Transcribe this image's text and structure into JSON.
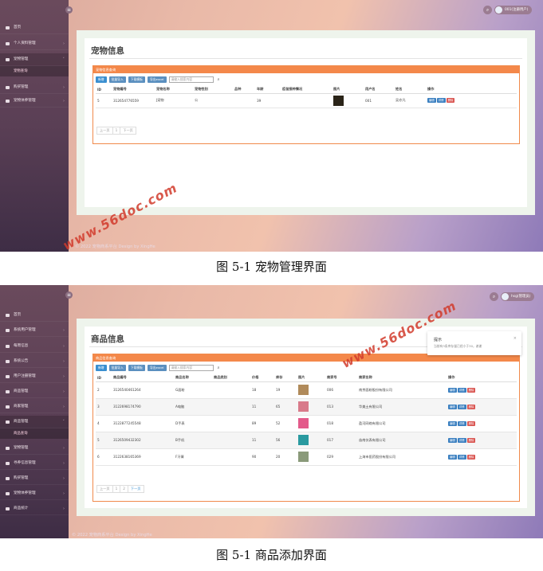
{
  "figure1": {
    "sidebar": {
      "items": [
        {
          "label": "首页"
        },
        {
          "label": "个人资料管理"
        },
        {
          "label": "宠物管理"
        },
        {
          "label": "购买管理"
        },
        {
          "label": "宠物体养管理"
        }
      ],
      "sub_label": "宠物查询"
    },
    "user_label": "001(注册用户)",
    "page_title": "宠物信息",
    "card_title": "宠物信息查询",
    "toolbar": {
      "add": "新增",
      "import": "批量导入",
      "template": "下载模板",
      "export": "导出excel",
      "search_placeholder": "请输入搜索内容"
    },
    "columns": [
      "ID",
      "宠物编号",
      "宠物名称",
      "宠物性别",
      "品种",
      "年龄",
      "疫苗接种情况",
      "图片",
      "用户名",
      "姓名",
      "操作"
    ],
    "rows": [
      {
        "id": "5",
        "code": "312654776559",
        "name": "J宠物",
        "sex": "公",
        "breed": "",
        "age": "39",
        "vaccine": "",
        "img": "",
        "user": "001",
        "realname": "吴亦凡"
      }
    ],
    "ops": {
      "edit": "编辑",
      "detail": "详情",
      "delete": "删除"
    },
    "pager": {
      "prev": "上一页",
      "pages": [
        "1"
      ],
      "next": "下一页"
    },
    "footer": "© 2022 宠物商系平台 Design by XingHe",
    "watermark": "www.56doc.com",
    "caption": "图 5-1  宠物管理界面"
  },
  "figure2": {
    "sidebar": {
      "items": [
        {
          "label": "首页"
        },
        {
          "label": "系统用户管理"
        },
        {
          "label": "每周信息"
        },
        {
          "label": "系统公告"
        },
        {
          "label": "用户注册管理"
        },
        {
          "label": "商品管理"
        },
        {
          "label": "商家管理"
        },
        {
          "label": "商品管理"
        },
        {
          "label": "宠物管理"
        },
        {
          "label": "寻养信息管理"
        },
        {
          "label": "购买管理"
        },
        {
          "label": "宠物体养管理"
        },
        {
          "label": "商品统计"
        }
      ],
      "sub_label": "商品查询"
    },
    "user_label": "hsg(管理员)",
    "page_title": "商品信息",
    "card_title": "商品信息查询",
    "toolbar": {
      "add": "新增",
      "import": "批量导入",
      "template": "下载模板",
      "export": "导出excel",
      "search_placeholder": "请输入搜索内容"
    },
    "columns": [
      "ID",
      "商品编号",
      "商品名称",
      "商品类别",
      "价格",
      "库存",
      "图片",
      "商家号",
      "商家名称",
      "操作"
    ],
    "rows": [
      {
        "id": "2",
        "code": "3126540461264",
        "name": "G面粉",
        "type": "",
        "price": "18",
        "stock": "19",
        "shop_no": "006",
        "shop": "南京面粉股份有限公司",
        "thumb": "#b08a5a"
      },
      {
        "id": "3",
        "code": "3122698174790",
        "name": "A电脑",
        "type": "",
        "price": "11",
        "stock": "65",
        "shop_no": "013",
        "shop": "华美土有限公司",
        "thumb": "#d87a8a"
      },
      {
        "id": "4",
        "code": "3122877245548",
        "name": "D手表",
        "type": "",
        "price": "89",
        "stock": "52",
        "shop_no": "018",
        "shop": "盈河网络有限公司",
        "thumb": "#e35a8a"
      },
      {
        "id": "5",
        "code": "3126509432302",
        "name": "B手机",
        "type": "",
        "price": "11",
        "stock": "56",
        "shop_no": "017",
        "shop": "苗南仪表有限公司",
        "thumb": "#2a9aa0"
      },
      {
        "id": "6",
        "code": "3122638165369",
        "name": "F牙膏",
        "type": "",
        "price": "90",
        "stock": "20",
        "shop_no": "029",
        "shop": "上海市医药股份有限公司",
        "thumb": "#8a9a7a"
      }
    ],
    "ops": {
      "edit": "编辑",
      "detail": "详情",
      "delete": "删除"
    },
    "pager": {
      "prev": "上一页",
      "pages": [
        "1",
        "2"
      ],
      "next": "下一页"
    },
    "toast": {
      "title": "提示",
      "message": "当前有3条库存量已经小于30，谢谢"
    },
    "footer": "© 2022 宠物商系平台 Design by XingHe",
    "watermark": "www.56doc.com",
    "caption": "图 5-1 商品添加界面"
  }
}
